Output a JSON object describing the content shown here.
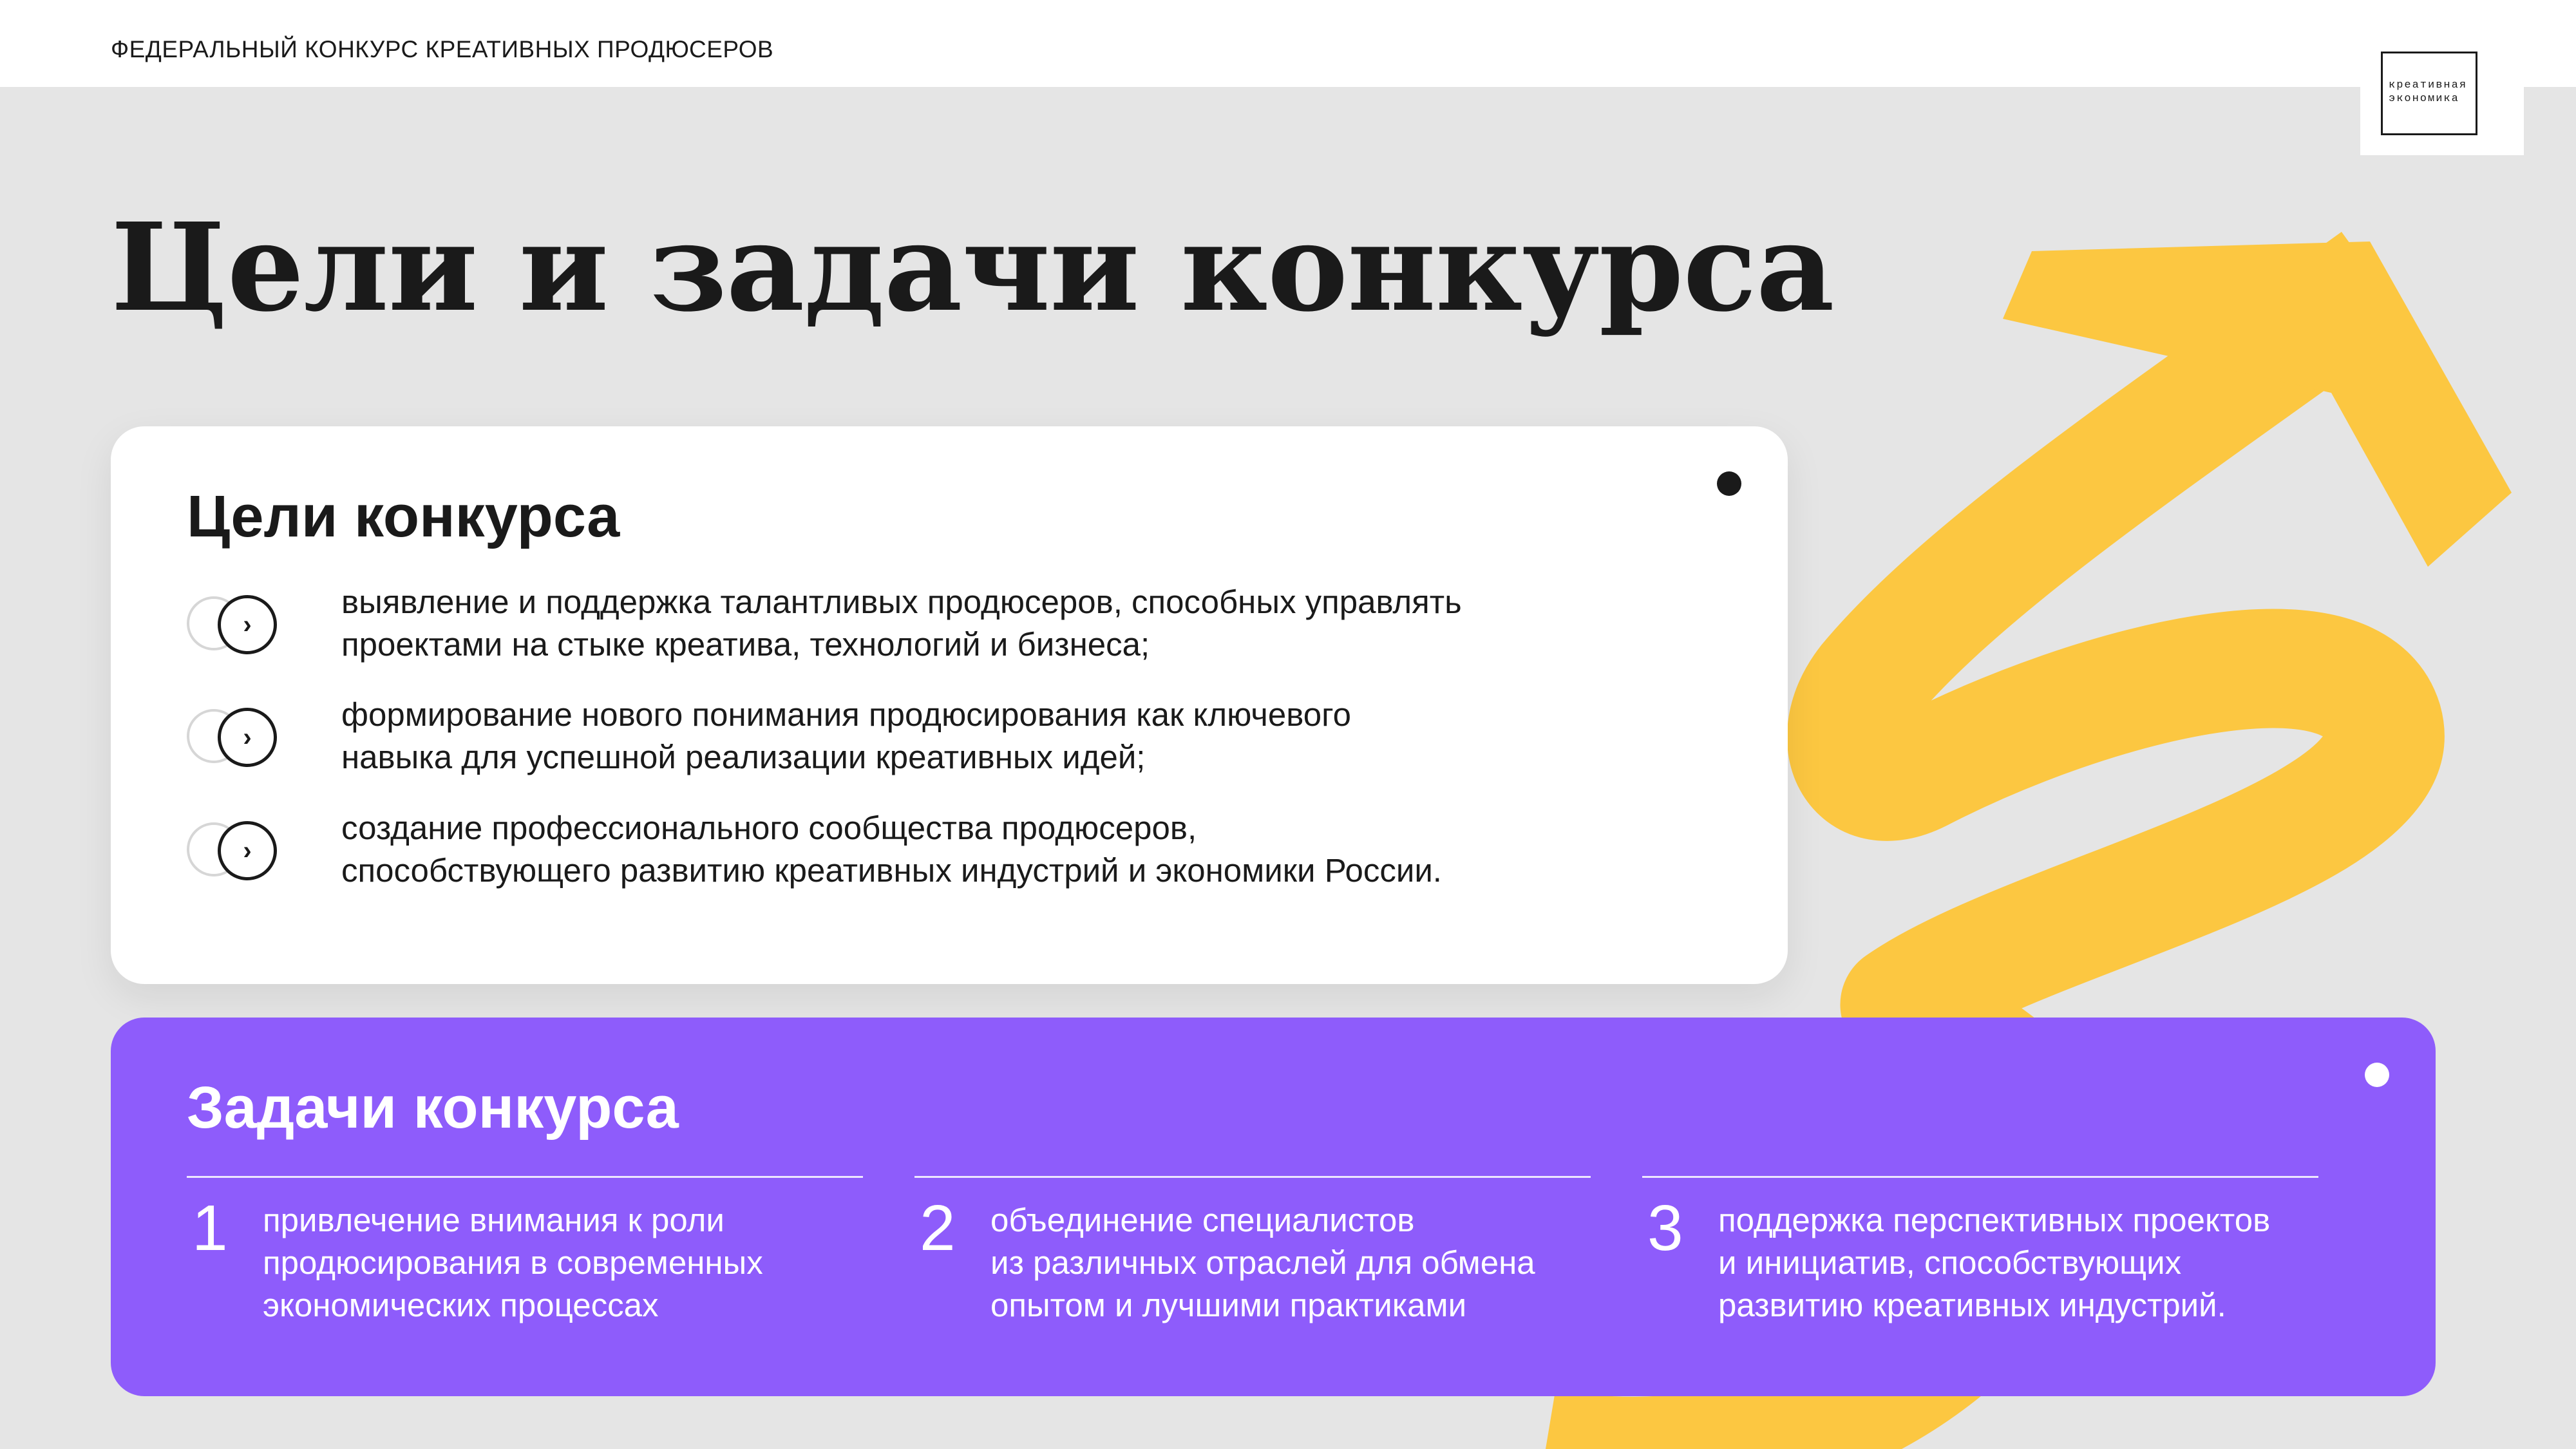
{
  "header": {
    "title": "ФЕДЕРАЛЬНЫЙ КОНКУРС КРЕАТИВНЫХ ПРОДЮСЕРОВ",
    "logo_line1": "креативная",
    "logo_line2": "экономика"
  },
  "page_title": "Цели и задачи конкурса",
  "goals": {
    "heading": "Цели конкурса",
    "bullet_glyph": "›",
    "items": [
      {
        "line1": "выявление и поддержка талантливых продюсеров, способных управлять",
        "line2": "проектами на стыке креатива, технологий и бизнеса;"
      },
      {
        "line1": "формирование нового понимания продюсирования как ключевого",
        "line2": "навыка для успешной реализации креативных идей;"
      },
      {
        "line1": "создание профессионального сообщества продюсеров,",
        "line2": "способствующего развитию креативных индустрий и экономики России."
      }
    ]
  },
  "tasks": {
    "heading": "Задачи конкурса",
    "items": [
      {
        "number": "1",
        "line1": "привлечение внимания к роли",
        "line2": "продюсирования в современных",
        "line3": "экономических процессах"
      },
      {
        "number": "2",
        "line1": "объединение специалистов",
        "line2": "из различных отраслей для обмена",
        "line3": "опытом и лучшими практиками"
      },
      {
        "number": "3",
        "line1": "поддержка перспективных проектов",
        "line2": "и инициатив, способствующих",
        "line3": "развитию креативных индустрий."
      }
    ]
  },
  "colors": {
    "background": "#e5e5e5",
    "accent_yellow": "#fcc741",
    "accent_purple": "#8e5cfb",
    "text_dark": "#1a1a1a"
  }
}
